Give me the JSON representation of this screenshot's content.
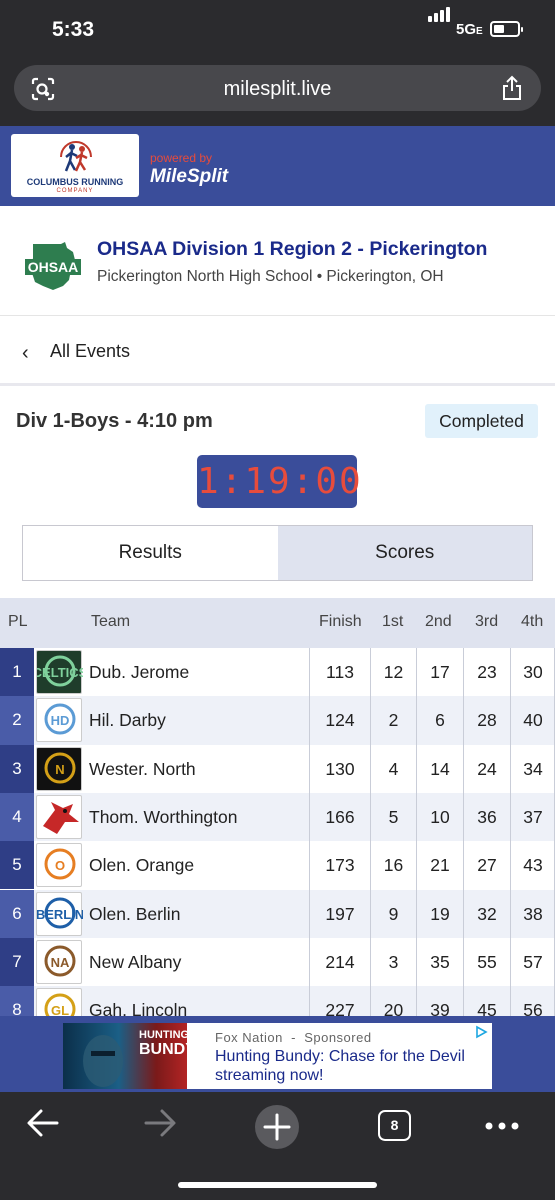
{
  "status_bar": {
    "time": "5:33",
    "network": "5G",
    "network_suffix": "E"
  },
  "browser": {
    "url": "milesplit.live",
    "tab_count": "8"
  },
  "sponsor": {
    "logo_line1": "COLUMBUS RUNNING",
    "logo_line2": "COMPANY",
    "powered_by": "powered by",
    "brand": "MileSplit"
  },
  "meet": {
    "org_logo": "OHSAA",
    "title": "OHSAA Division 1 Region 2 - Pickerington",
    "location": "Pickerington North High School • Pickerington, OH"
  },
  "nav": {
    "back_label": "All Events"
  },
  "event": {
    "title": "Div 1-Boys - 4:10 pm",
    "status": "Completed",
    "clock": "1:19:00"
  },
  "tabs": [
    {
      "label": "Results"
    },
    {
      "label": "Scores"
    }
  ],
  "table": {
    "headers": {
      "pl": "PL",
      "team": "Team",
      "finish": "Finish",
      "r1": "1st",
      "r2": "2nd",
      "r3": "3rd",
      "r4": "4th"
    },
    "rows": [
      {
        "pl": "1",
        "team": "Dub. Jerome",
        "finish": "113",
        "r1": "12",
        "r2": "17",
        "r3": "23",
        "r4": "30",
        "mascot": "CELTICS"
      },
      {
        "pl": "2",
        "team": "Hil. Darby",
        "finish": "124",
        "r1": "2",
        "r2": "6",
        "r3": "28",
        "r4": "40",
        "mascot": "HD"
      },
      {
        "pl": "3",
        "team": "Wester. North",
        "finish": "130",
        "r1": "4",
        "r2": "14",
        "r3": "24",
        "r4": "34",
        "mascot": "N"
      },
      {
        "pl": "4",
        "team": "Thom. Worthington",
        "finish": "166",
        "r1": "5",
        "r2": "10",
        "r3": "36",
        "r4": "37",
        "mascot": ""
      },
      {
        "pl": "5",
        "team": "Olen. Orange",
        "finish": "173",
        "r1": "16",
        "r2": "21",
        "r3": "27",
        "r4": "43",
        "mascot": "O"
      },
      {
        "pl": "6",
        "team": "Olen. Berlin",
        "finish": "197",
        "r1": "9",
        "r2": "19",
        "r3": "32",
        "r4": "38",
        "mascot": "BERLIN"
      },
      {
        "pl": "7",
        "team": "New Albany",
        "finish": "214",
        "r1": "3",
        "r2": "35",
        "r3": "55",
        "r4": "57",
        "mascot": "NA"
      },
      {
        "pl": "8",
        "team": "Gah. Lincoln",
        "finish": "227",
        "r1": "20",
        "r2": "39",
        "r3": "45",
        "r4": "56",
        "mascot": "GL"
      }
    ]
  },
  "ad": {
    "source": "Fox Nation",
    "separator": "-",
    "sponsored": "Sponsored",
    "headline": "Hunting Bundy: Chase for the Devil streaming now!",
    "image_text_1": "HUNTING",
    "image_text_2": "BUNDY"
  },
  "colors": {
    "brand_blue": "#3a4d9a",
    "title_blue": "#1a2a8a",
    "clock_red": "#e74c3c",
    "status_badge_bg": "#e1f1fb",
    "pl_dark": "#2f3e86",
    "pl_light": "#4a5ca8"
  }
}
